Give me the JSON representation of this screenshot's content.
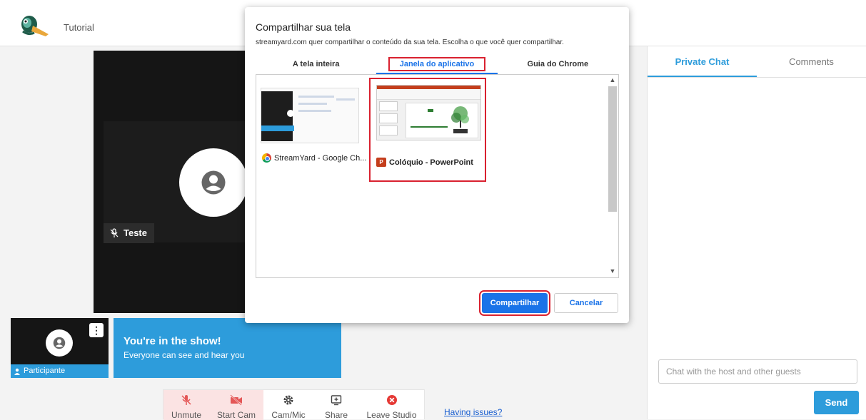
{
  "header": {
    "app_title": "Tutorial"
  },
  "stage": {
    "participant_name": "Teste",
    "thumb_label": "Participante",
    "banner_title": "You're in the show!",
    "banner_subtitle": "Everyone can see and hear you"
  },
  "toolbar": {
    "unmute": "Unmute",
    "start_cam": "Start Cam",
    "cam_mic": "Cam/Mic",
    "share": "Share",
    "leave": "Leave Studio",
    "issues": "Having issues?"
  },
  "chat": {
    "tabs": [
      "Private Chat",
      "Comments"
    ],
    "input_placeholder": "Chat with the host and other guests",
    "send_label": "Send"
  },
  "dialog": {
    "title": "Compartilhar sua tela",
    "subtitle": "streamyard.com quer compartilhar o conteúdo da sua tela. Escolha o que você quer compartilhar.",
    "tabs": [
      "A tela inteira",
      "Janela do aplicativo",
      "Guia do Chrome"
    ],
    "windows": [
      {
        "label": "StreamYard - Google Ch...",
        "icon": "chrome-icon"
      },
      {
        "label": "Colóquio - PowerPoint",
        "icon": "powerpoint-icon"
      }
    ],
    "share_label": "Compartilhar",
    "cancel_label": "Cancelar"
  },
  "colors": {
    "accent": "#2d9cdb",
    "dialog_blue": "#1a73e8",
    "highlight": "#d9212f"
  }
}
